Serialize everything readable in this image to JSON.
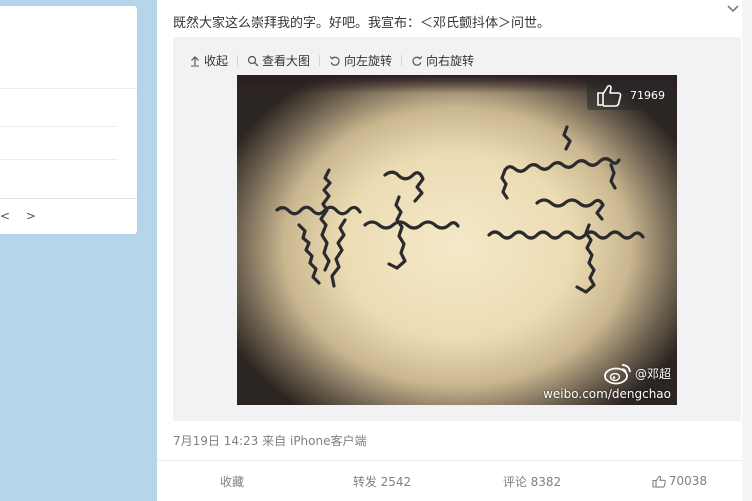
{
  "left_card": {
    "arrows": "< >"
  },
  "post": {
    "text": "既然大家这么崇拜我的字。好吧。我宣布：＜邓氏颤抖体＞问世。"
  },
  "toolbar": {
    "collapse_label": "收起",
    "view_large_label": "查看大图",
    "rotate_left_label": "向左旋转",
    "rotate_right_label": "向右旋转"
  },
  "photo": {
    "like_count": "71969",
    "handwritten_text": "好字",
    "watermark_user": "@邓超",
    "watermark_url": "weibo.com/dengchao"
  },
  "meta": {
    "date": "7月19日 14:23",
    "source_prefix": "来自",
    "source": "iPhone客户端"
  },
  "actions": {
    "favorite": "收藏",
    "repost": "转发 2542",
    "comment": "评论 8382",
    "like": "70038"
  },
  "icons": {
    "collapse": "arrow-up-icon",
    "view_large": "magnifier-icon",
    "rotate_left": "rotate-left-icon",
    "rotate_right": "rotate-right-icon",
    "like": "thumbs-up-icon",
    "more": "chevron-down-icon",
    "weibo_logo": "weibo-logo-icon"
  },
  "colors": {
    "page_bg": "#b5d5e9",
    "card_bg": "#ffffff",
    "media_bg": "#f2f2f5",
    "text_primary": "#333333",
    "text_secondary": "#808080"
  }
}
